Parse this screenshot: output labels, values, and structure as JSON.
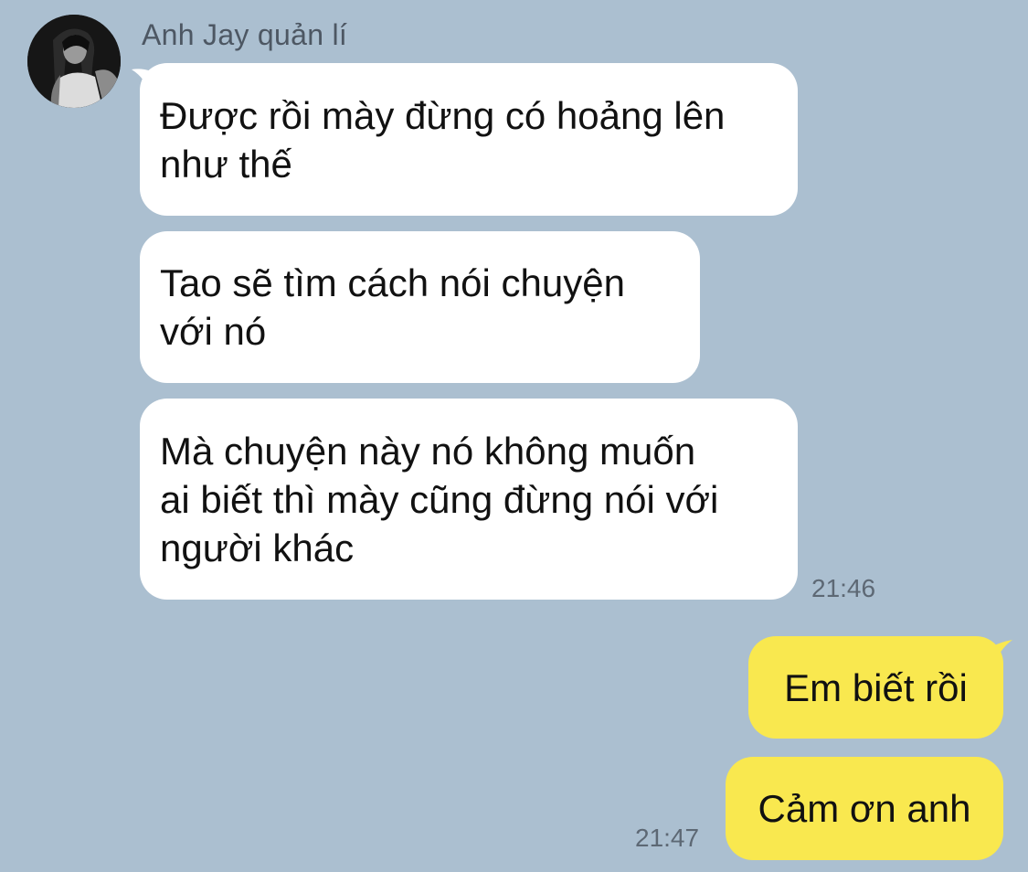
{
  "colors": {
    "background": "#abbfd0",
    "incoming_bubble": "#ffffff",
    "outgoing_bubble": "#f9e84f"
  },
  "contact": {
    "name": "Anh Jay quản lí",
    "avatar_icon": "user-avatar-photo"
  },
  "messages": [
    {
      "direction": "incoming",
      "text": "Được rồi mày đừng có hoảng lên\nnhư thế"
    },
    {
      "direction": "incoming",
      "text": "Tao sẽ tìm cách nói chuyện\nvới nó"
    },
    {
      "direction": "incoming",
      "text": "Mà chuyện này nó không muốn\nai biết thì mày cũng đừng nói với\nngười khác"
    },
    {
      "direction": "outgoing",
      "text": "Em biết rồi"
    },
    {
      "direction": "outgoing",
      "text": "Cảm ơn anh"
    }
  ],
  "timestamps": {
    "incoming_group": "21:46",
    "outgoing_group": "21:47"
  }
}
